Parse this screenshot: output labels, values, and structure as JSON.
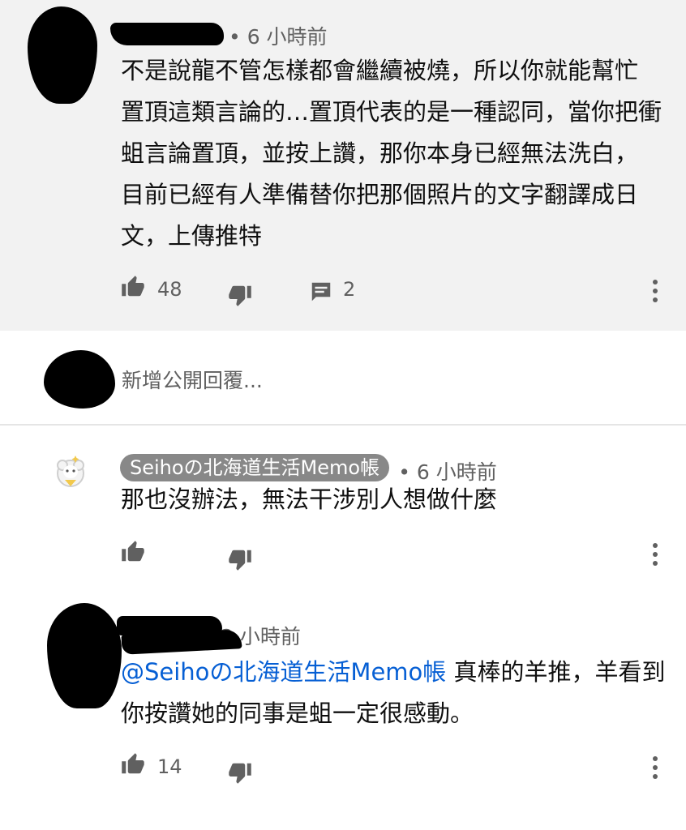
{
  "comment_main": {
    "time": "• 6 小時前",
    "lines": [
      "不是說龍不管怎樣都會繼續被燒，所以你就能幫忙",
      "置頂這類言論的…置頂代表的是一種認同，當你把衝",
      "蛆言論置頂，並按上讚，那你本身已經無法洗白，",
      "目前已經有人準備替你把那個照片的文字翻譯成日",
      "文，上傳推特"
    ],
    "likes": "48",
    "replies": "2"
  },
  "reply_input": {
    "placeholder": "新增公開回覆..."
  },
  "reply_1": {
    "author": "Seihoの北海道生活Memo帳",
    "time": "• 6 小時前",
    "text": "那也沒辦法，無法干涉別人想做什麼"
  },
  "reply_2": {
    "time": "2 小時前",
    "mention": "@Seihoの北海道生活Memo帳",
    "line1_rest": " 真棒的羊推，羊看到",
    "line2": "你按讚她的同事是蛆一定很感動。",
    "likes": "14"
  },
  "icons": {
    "like": "thumbs-up-icon",
    "dislike": "thumbs-down-icon",
    "reply": "comment-icon",
    "more": "more-vert-icon"
  },
  "colors": {
    "top_background": "#f2f2f2",
    "meta_gray": "#606060",
    "mention_blue": "#065fd4",
    "author_pill": "#888888"
  }
}
